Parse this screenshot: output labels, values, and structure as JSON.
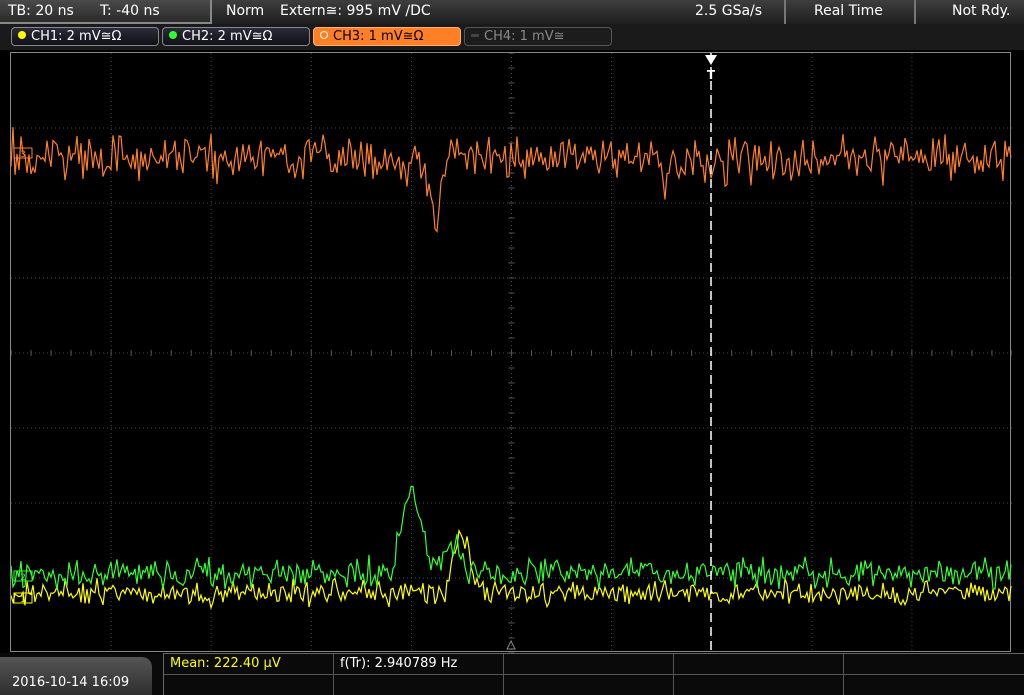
{
  "topbar": {
    "timebase": "TB: 20 ns",
    "trigger_offset": "T: -40 ns",
    "trigger_mode": "Norm",
    "trigger_source": "Extern≅: 995 mV ∕DC",
    "sample_rate": "2.5 GSa/s",
    "acq_mode": "Real Time",
    "status": "Not Rdy."
  },
  "channels": [
    {
      "label": "CH1: 2 mV≅Ω",
      "color": "#ffff00",
      "state": "on"
    },
    {
      "label": "CH2: 2 mV≅Ω",
      "color": "#33ff33",
      "state": "on"
    },
    {
      "label": "CH3: 1 mV≅Ω",
      "color": "#ff7f27",
      "state": "selected"
    },
    {
      "label": "CH4: 1 mV≅",
      "color": "#666666",
      "state": "off"
    }
  ],
  "plot": {
    "trigger_marker": "T",
    "ch3_marker": "3",
    "ch2_marker": "2",
    "ch1_marker": "1"
  },
  "bottombar": {
    "datetime": "2016-10-14 16:09",
    "mean_label": "Mean: 222.40 µV",
    "frequency_label": "f(Tr): 2.940789 Hz"
  },
  "colors": {
    "ch1": "#ffff00",
    "ch2": "#33ff33",
    "ch3": "#ff7f27",
    "grid": "#444444"
  }
}
